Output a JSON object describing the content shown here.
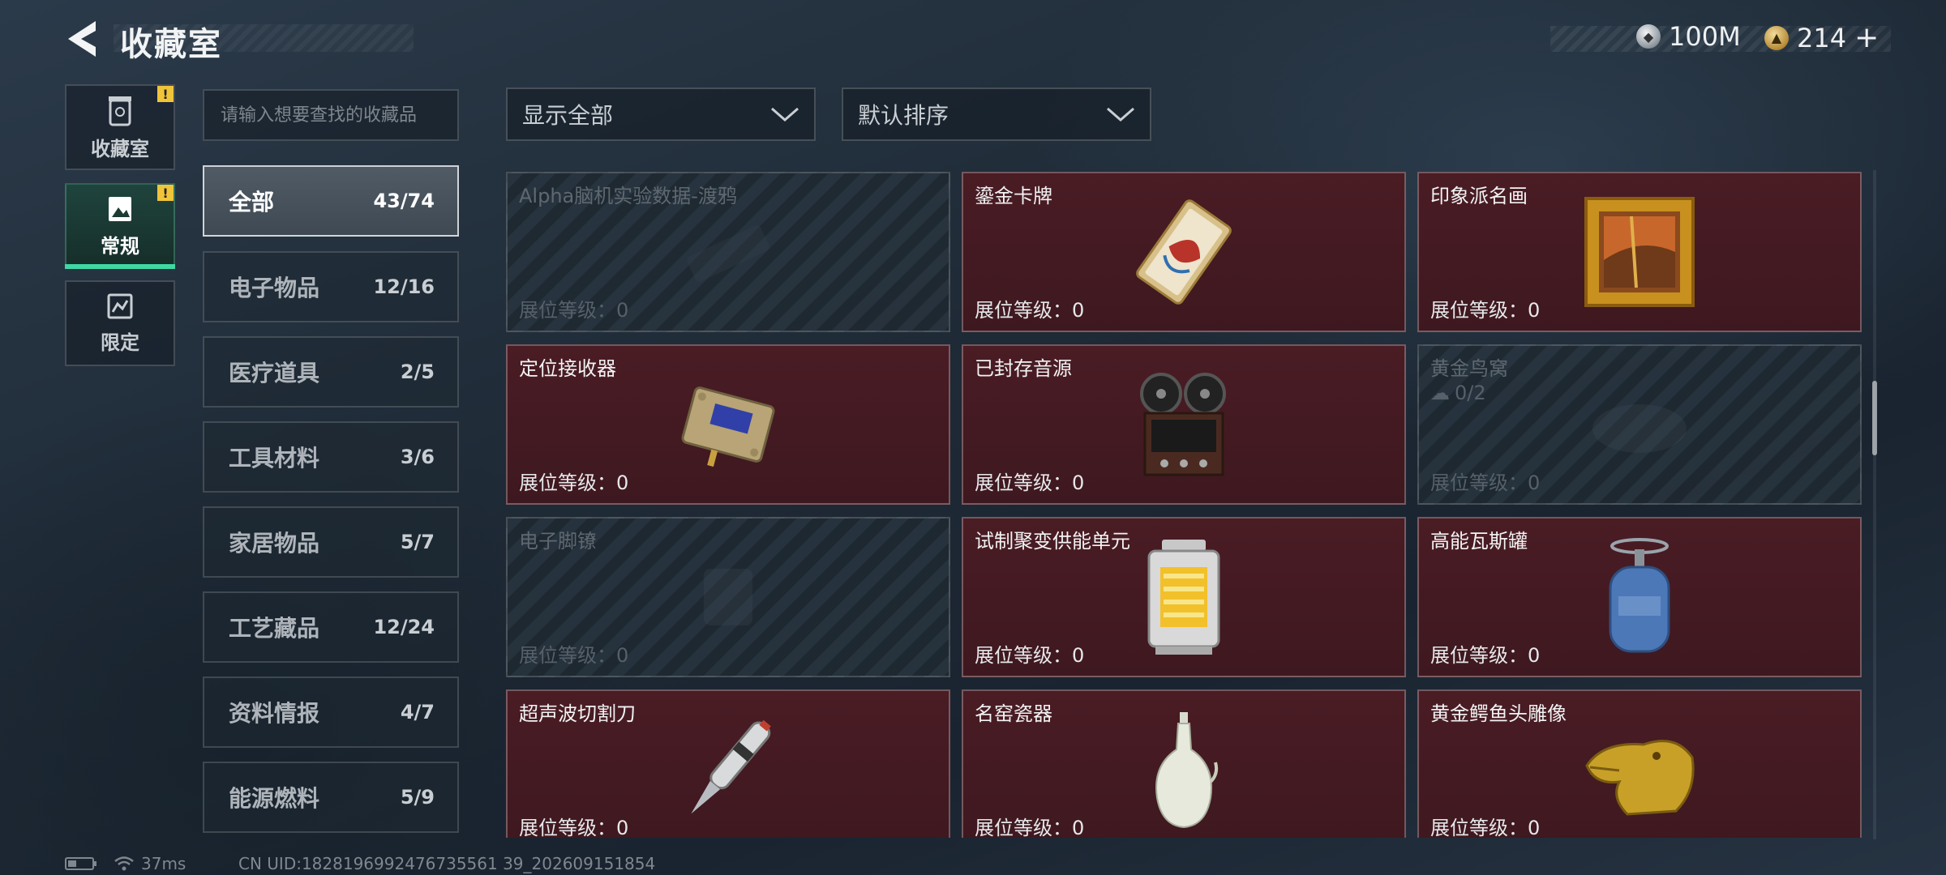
{
  "header": {
    "title": "收藏室",
    "currency": [
      {
        "icon": "silver-coin-icon",
        "value": "100M"
      },
      {
        "icon": "gold-coin-icon",
        "value": "214"
      }
    ],
    "add_label": "+"
  },
  "sidebar": {
    "tabs": [
      {
        "label": "收藏室",
        "icon": "trash-can-icon",
        "badge": "!"
      },
      {
        "label": "常规",
        "icon": "picture-frame-icon",
        "badge": "!",
        "active": true
      },
      {
        "label": "限定",
        "icon": "limited-icon"
      }
    ]
  },
  "search": {
    "placeholder": "请输入想要查找的收藏品"
  },
  "categories": [
    {
      "name": "全部",
      "count": "43/74",
      "active": true
    },
    {
      "name": "电子物品",
      "count": "12/16"
    },
    {
      "name": "医疗道具",
      "count": "2/5"
    },
    {
      "name": "工具材料",
      "count": "3/6"
    },
    {
      "name": "家居物品",
      "count": "5/7"
    },
    {
      "name": "工艺藏品",
      "count": "12/24"
    },
    {
      "name": "资料情报",
      "count": "4/7"
    },
    {
      "name": "能源燃料",
      "count": "5/9"
    }
  ],
  "filters": {
    "display": "显示全部",
    "sort": "默认排序"
  },
  "items": [
    {
      "name": "Alpha脑机实验数据-渡鸦",
      "level": "展位等级：0",
      "owned": false
    },
    {
      "name": "鎏金卡牌",
      "level": "展位等级：0",
      "owned": true
    },
    {
      "name": "印象派名画",
      "level": "展位等级：0",
      "owned": true
    },
    {
      "name": "定位接收器",
      "level": "展位等级：0",
      "owned": true
    },
    {
      "name": "已封存音源",
      "level": "展位等级：0",
      "owned": true
    },
    {
      "name": "黄金鸟窝",
      "level": "展位等级：0",
      "owned": false,
      "progress": "0/2"
    },
    {
      "name": "电子脚镣",
      "level": "展位等级：0",
      "owned": false
    },
    {
      "name": "试制聚变供能单元",
      "level": "展位等级：0",
      "owned": true
    },
    {
      "name": "高能瓦斯罐",
      "level": "展位等级：0",
      "owned": true
    },
    {
      "name": "超声波切割刀",
      "level": "展位等级：0",
      "owned": true
    },
    {
      "name": "名窑瓷器",
      "level": "展位等级：0",
      "owned": true
    },
    {
      "name": "黄金鳄鱼头雕像",
      "level": "展位等级：0",
      "owned": true
    }
  ],
  "status_bar": {
    "ping": "37ms",
    "uid": "CN UID:1828196992476735561 39_202609151854"
  }
}
